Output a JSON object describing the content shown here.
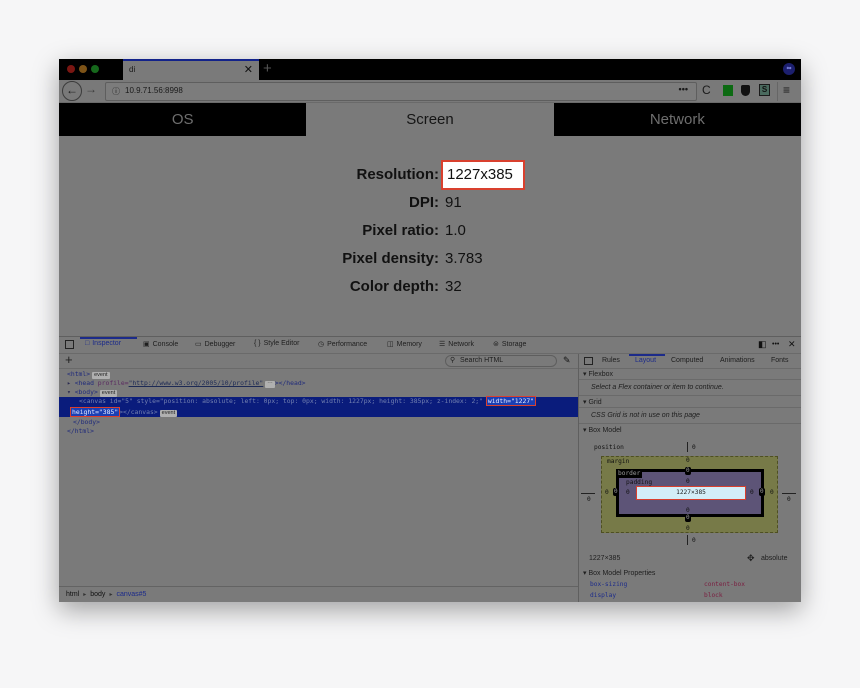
{
  "browser": {
    "tab_title": "di",
    "tab_close": "✕",
    "new_tab": "+",
    "account_icon": "∞",
    "url": "10.9.71.56:8998",
    "url_info_icon": "ⓘ",
    "url_more": "•••",
    "back_icon": "←",
    "forward_icon": "→",
    "reload_icon": "C",
    "extension_s": "S",
    "menu_icon": "≡"
  },
  "page": {
    "tabs": [
      {
        "label": "OS",
        "active": false
      },
      {
        "label": "Screen",
        "active": true
      },
      {
        "label": "Network",
        "active": false
      }
    ],
    "info": [
      {
        "label": "Resolution:",
        "value": "1227x385",
        "highlighted": true
      },
      {
        "label": "DPI:",
        "value": "91"
      },
      {
        "label": "Pixel ratio:",
        "value": "1.0"
      },
      {
        "label": "Pixel density:",
        "value": "3.783"
      },
      {
        "label": "Color depth:",
        "value": "32"
      }
    ]
  },
  "devtools": {
    "tabs": [
      {
        "label": "Inspector",
        "icon": "□",
        "active": true
      },
      {
        "label": "Console",
        "icon": "▣"
      },
      {
        "label": "Debugger",
        "icon": "▭"
      },
      {
        "label": "Style Editor",
        "icon": "{ }"
      },
      {
        "label": "Performance",
        "icon": "◷"
      },
      {
        "label": "Memory",
        "icon": "◫"
      },
      {
        "label": "Network",
        "icon": "☰"
      },
      {
        "label": "Storage",
        "icon": "⊜"
      }
    ],
    "right_icons": {
      "dock": "◧",
      "more": "•••",
      "close": "✕"
    },
    "markup": {
      "add_node": "+",
      "search_placeholder": "Search HTML",
      "search_icon": "⚲",
      "eyedropper_icon": "✎",
      "lines": {
        "html_open": "<html>",
        "head": "<head ",
        "head_attr": "profile=",
        "head_val": "\"http://www.w3.org/2005/10/profile\"",
        "head_close": "></head>",
        "body_open": "<body>",
        "canvas_line": "<canvas id=\"5\" style=\"position: absolute; left: 0px; top: 0px; width: 1227px; height: 385px; z-index: 2;\"",
        "canvas_width_attr": "width=\"1227\"",
        "canvas_height_attr": "height=\"385\"",
        "canvas_close": "></canvas>",
        "body_close": "</body>",
        "html_close": "</html>",
        "event_badge": "event",
        "ellipsis_badge": "⋯"
      },
      "breadcrumbs": [
        "html",
        "body",
        "canvas#5"
      ],
      "breadcrumb_sep": "▸"
    },
    "sidebar": {
      "tabs": [
        {
          "label": "Rules"
        },
        {
          "label": "Layout",
          "active": true
        },
        {
          "label": "Computed"
        },
        {
          "label": "Animations"
        },
        {
          "label": "Fonts"
        }
      ],
      "flexbox": {
        "title": "Flexbox",
        "message": "Select a Flex container or item to continue."
      },
      "grid": {
        "title": "Grid",
        "message": "CSS Grid is not in use on this page"
      },
      "box_model": {
        "title": "Box Model",
        "position_label": "position",
        "margin_label": "margin",
        "border_label": "border",
        "padding_label": "padding",
        "content": "1227×385",
        "position": {
          "top": "0",
          "right": "0",
          "bottom": "0",
          "left": "0"
        },
        "margin": {
          "top": "0",
          "right": "0",
          "bottom": "0",
          "left": "0"
        },
        "border": {
          "top": "0",
          "right": "0",
          "bottom": "0",
          "left": "0"
        },
        "padding": {
          "top": "0",
          "right": "0",
          "bottom": "0",
          "left": "0"
        },
        "size_readout": "1227×385",
        "position_type": "absolute",
        "position_icon": "✥"
      },
      "box_model_properties": {
        "title": "Box Model Properties",
        "props": [
          {
            "name": "box-sizing",
            "value": "content-box"
          },
          {
            "name": "display",
            "value": "block"
          }
        ]
      },
      "caret": "▾"
    }
  }
}
